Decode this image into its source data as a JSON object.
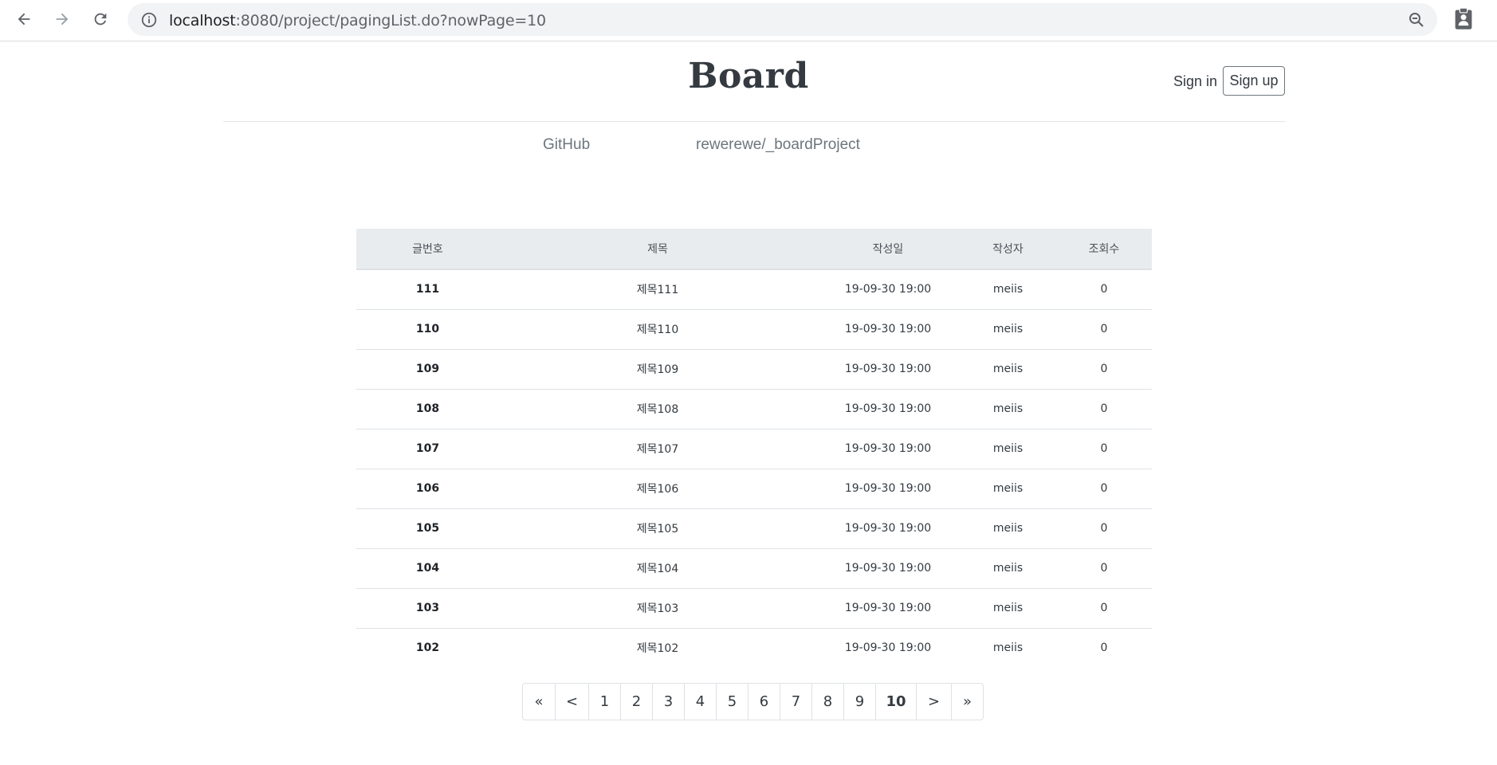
{
  "browser": {
    "url_host": "localhost",
    "url_path": ":8080/project/pagingList.do?nowPage=10",
    "icons": [
      "back-arrow-icon",
      "forward-arrow-icon",
      "reload-icon",
      "info-icon",
      "zoom-icon",
      "clipboard-icon"
    ]
  },
  "header": {
    "brand": "Board",
    "sign_in": "Sign in",
    "sign_up": "Sign up"
  },
  "nav": {
    "github": "GitHub",
    "repo": "rewerewe/_boardProject"
  },
  "table": {
    "headers": {
      "num": "글번호",
      "title": "제목",
      "date": "작성일",
      "author": "작성자",
      "views": "조회수"
    },
    "rows": [
      {
        "num": "111",
        "title": "제목111",
        "date": "19-09-30 19:00",
        "author": "meiis",
        "views": "0"
      },
      {
        "num": "110",
        "title": "제목110",
        "date": "19-09-30 19:00",
        "author": "meiis",
        "views": "0"
      },
      {
        "num": "109",
        "title": "제목109",
        "date": "19-09-30 19:00",
        "author": "meiis",
        "views": "0"
      },
      {
        "num": "108",
        "title": "제목108",
        "date": "19-09-30 19:00",
        "author": "meiis",
        "views": "0"
      },
      {
        "num": "107",
        "title": "제목107",
        "date": "19-09-30 19:00",
        "author": "meiis",
        "views": "0"
      },
      {
        "num": "106",
        "title": "제목106",
        "date": "19-09-30 19:00",
        "author": "meiis",
        "views": "0"
      },
      {
        "num": "105",
        "title": "제목105",
        "date": "19-09-30 19:00",
        "author": "meiis",
        "views": "0"
      },
      {
        "num": "104",
        "title": "제목104",
        "date": "19-09-30 19:00",
        "author": "meiis",
        "views": "0"
      },
      {
        "num": "103",
        "title": "제목103",
        "date": "19-09-30 19:00",
        "author": "meiis",
        "views": "0"
      },
      {
        "num": "102",
        "title": "제목102",
        "date": "19-09-30 19:00",
        "author": "meiis",
        "views": "0"
      }
    ]
  },
  "pagination": {
    "first": "«",
    "prev": "<",
    "pages": [
      "1",
      "2",
      "3",
      "4",
      "5",
      "6",
      "7",
      "8",
      "9",
      "10"
    ],
    "current": "10",
    "next": ">",
    "last": "»"
  }
}
